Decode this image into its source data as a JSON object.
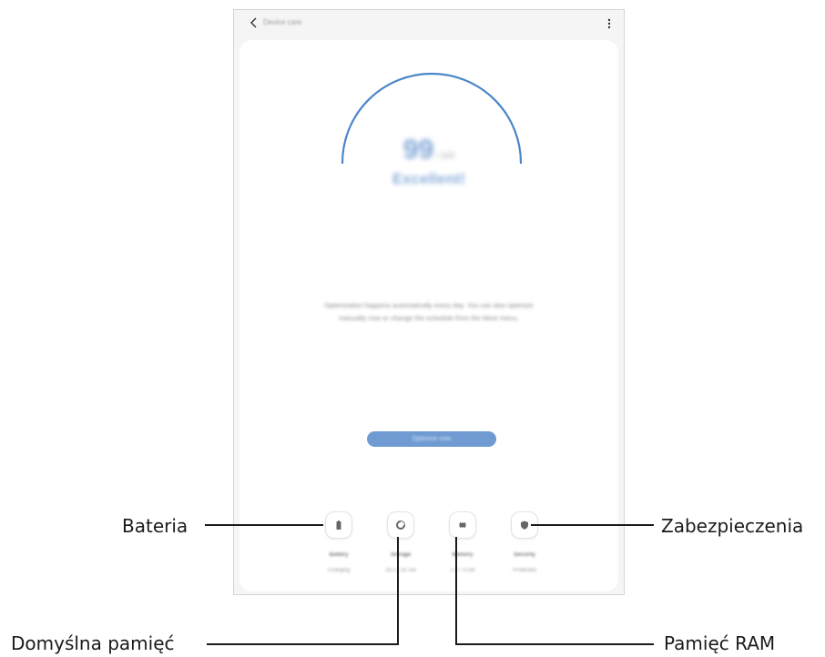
{
  "app_bar": {
    "title": "Device care"
  },
  "score": {
    "value": "99",
    "max": "/ 100",
    "status": "Excellent!"
  },
  "description": "Optimization happens automatically every day. You can also optimize manually now or change the schedule from the More menu.",
  "optimize_button": "Optimize now",
  "tools": [
    {
      "name": "Battery",
      "value": "Charging",
      "icon": "battery-icon"
    },
    {
      "name": "Storage",
      "value": "26.5 / 32 GB",
      "icon": "storage-icon"
    },
    {
      "name": "Memory",
      "value": "1.0 / 3 GB",
      "icon": "memory-icon"
    },
    {
      "name": "Security",
      "value": "Protected",
      "icon": "shield-icon"
    }
  ],
  "callouts": {
    "battery": "Bateria",
    "security": "Zabezpieczenia",
    "storage": "Domyślna pamięć",
    "memory": "Pamięć RAM"
  },
  "colors": {
    "accent": "#4a86c8",
    "button": "#6f9bd2",
    "card": "#ffffff",
    "device_bg": "#f5f5f5",
    "line": "#1a1a1a"
  }
}
